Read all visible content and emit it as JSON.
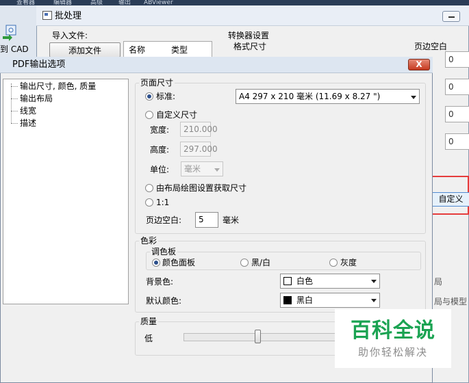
{
  "app": {
    "tabs": [
      "查看器",
      "编辑器",
      "高级",
      "输出",
      "ABViewer"
    ],
    "left_label": "到 CAD"
  },
  "batch": {
    "title": "批处理",
    "import_label": "导入文件:",
    "add_file_button": "添加文件",
    "list_columns": [
      "名称",
      "类型"
    ],
    "converter_settings": "转换器设置",
    "format_size": "格式尺寸",
    "page_margin": "页边空白",
    "margin_values": [
      "0",
      "0",
      "0",
      "0"
    ],
    "custom_button": "自定义",
    "right_texts": [
      "局",
      "局与模型"
    ]
  },
  "pdf": {
    "title": "PDF输出选项",
    "close_label": "X",
    "tree": [
      "输出尺寸, 颜色, 质量",
      "输出布局",
      "线宽",
      "描述"
    ],
    "page_size": {
      "group_title": "页面尺寸",
      "standard_label": "标准:",
      "standard_value": "A4 297 x 210 毫米 (11.69 x 8.27 \")",
      "custom_label": "自定义尺寸",
      "width_label": "宽度:",
      "width_value": "210.000",
      "height_label": "高度:",
      "height_value": "297.000",
      "unit_label": "单位:",
      "unit_value": "毫米",
      "from_layout_label": "由布局绘图设置获取尺寸",
      "one_to_one_label": "1:1",
      "margin_label": "页边空白:",
      "margin_value": "5",
      "margin_unit": "毫米"
    },
    "color": {
      "group_title": "色彩",
      "palette_title": "调色板",
      "palette_options": [
        "颜色面板",
        "黑/白",
        "灰度"
      ],
      "background_label": "背景色:",
      "background_value": "白色",
      "background_swatch": "#ffffff",
      "default_color_label": "默认颜色:",
      "default_color_value": "黑白",
      "default_color_swatch": "#000000"
    },
    "quality": {
      "group_title": "质量",
      "low_label": "低",
      "level": 0.48
    }
  },
  "watermark": {
    "title": "百科全说",
    "subtitle": "助你轻松解决"
  }
}
